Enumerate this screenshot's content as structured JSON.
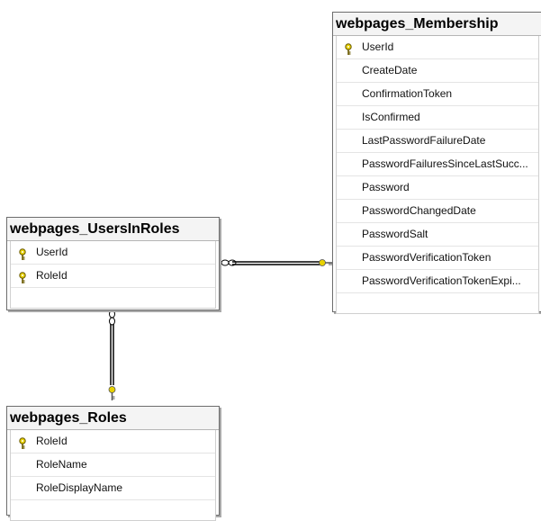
{
  "tables": {
    "membership": {
      "title": "webpages_Membership",
      "columns": [
        {
          "name": "UserId",
          "key": true
        },
        {
          "name": "CreateDate",
          "key": false
        },
        {
          "name": "ConfirmationToken",
          "key": false
        },
        {
          "name": "IsConfirmed",
          "key": false
        },
        {
          "name": "LastPasswordFailureDate",
          "key": false
        },
        {
          "name": "PasswordFailuresSinceLastSucc...",
          "key": false
        },
        {
          "name": "Password",
          "key": false
        },
        {
          "name": "PasswordChangedDate",
          "key": false
        },
        {
          "name": "PasswordSalt",
          "key": false
        },
        {
          "name": "PasswordVerificationToken",
          "key": false
        },
        {
          "name": "PasswordVerificationTokenExpi...",
          "key": false
        }
      ]
    },
    "users_in_roles": {
      "title": "webpages_UsersInRoles",
      "columns": [
        {
          "name": "UserId",
          "key": true
        },
        {
          "name": "RoleId",
          "key": true
        }
      ]
    },
    "roles": {
      "title": "webpages_Roles",
      "columns": [
        {
          "name": "RoleId",
          "key": true
        },
        {
          "name": "RoleName",
          "key": false
        },
        {
          "name": "RoleDisplayName",
          "key": false
        }
      ]
    }
  },
  "relationships": [
    {
      "from": "webpages_UsersInRoles",
      "to": "webpages_Membership",
      "from_end": "many",
      "to_end": "one"
    },
    {
      "from": "webpages_UsersInRoles",
      "to": "webpages_Roles",
      "from_end": "many",
      "to_end": "one"
    }
  ],
  "colors": {
    "key_icon": "#e8d200",
    "border": "#6d6d6d",
    "line": "#000000"
  }
}
